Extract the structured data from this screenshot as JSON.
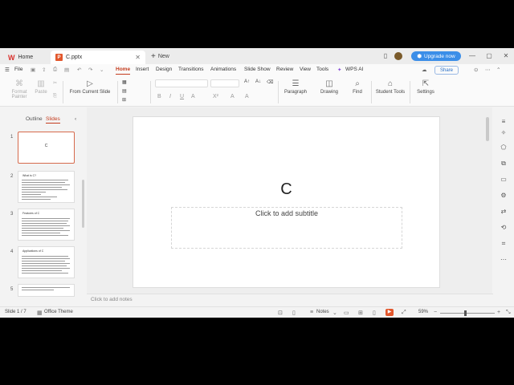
{
  "titlebar": {
    "home_tab": "Home",
    "doc_tab": "C.pptx",
    "new_tab": "New",
    "upgrade": "Upgrade now"
  },
  "menubar": {
    "file": "File",
    "items": [
      "Home",
      "Insert",
      "Design",
      "Transitions",
      "Animations",
      "Slide Show",
      "Review",
      "View",
      "Tools"
    ],
    "wps_ai": "WPS AI",
    "share": "Share"
  },
  "ribbon": {
    "format_painter": "Format Painter",
    "paste": "Paste",
    "from_current_slide": "From Current Slide",
    "paragraph": "Paragraph",
    "drawing": "Drawing",
    "find": "Find",
    "student_tools": "Student Tools",
    "settings": "Settings",
    "font_buttons": [
      "B",
      "I",
      "U",
      "A",
      "X²",
      "A",
      "A"
    ]
  },
  "leftpanel": {
    "outline_tab": "Outline",
    "slides_tab": "Slides",
    "thumbnails": [
      {
        "num": "1",
        "text": "C"
      },
      {
        "num": "2",
        "text": "What is C?"
      },
      {
        "num": "3",
        "text": "Features of C"
      },
      {
        "num": "4",
        "text": "Applications of C"
      },
      {
        "num": "5",
        "text": ""
      }
    ]
  },
  "slide": {
    "title": "C",
    "subtitle_placeholder": "Click to add subtitle"
  },
  "notes": {
    "placeholder": "Click to add notes"
  },
  "statusbar": {
    "slide_counter": "Slide 1 / 7",
    "theme": "Office Theme",
    "notes": "Notes",
    "zoom": "59%"
  },
  "colors": {
    "accent": "#c43b1d",
    "upgrade_blue": "#3b8ee8"
  }
}
